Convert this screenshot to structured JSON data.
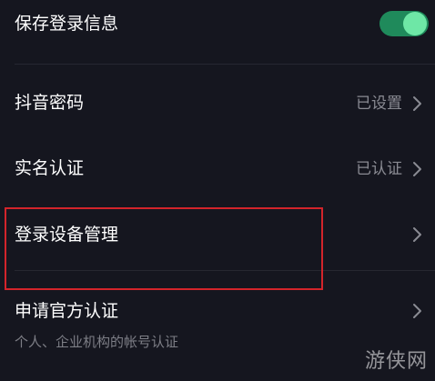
{
  "settings": {
    "save_login": {
      "label": "保存登录信息",
      "toggle_on": true
    },
    "douyin_password": {
      "label": "抖音密码",
      "value": "已设置"
    },
    "real_name": {
      "label": "实名认证",
      "value": "已认证"
    },
    "device_manage": {
      "label": "登录设备管理"
    },
    "official_cert": {
      "label": "申请官方认证",
      "sub": "个人、企业机构的帐号认证"
    }
  },
  "colors": {
    "background": "#15161f",
    "toggle_track": "#1f8a5b",
    "toggle_knob": "#6ee7a6",
    "highlight_border": "#d3242b"
  },
  "watermark": "游侠网"
}
